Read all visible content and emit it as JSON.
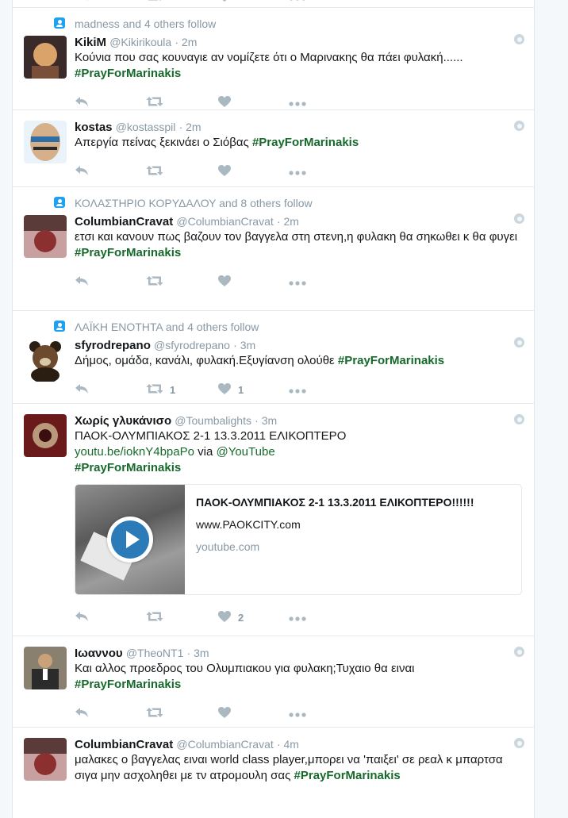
{
  "tweets": [
    {
      "context": "",
      "name": "",
      "handle": "",
      "time": "",
      "lines": [],
      "retweets": "",
      "likes": "",
      "avatar_colors": [
        "#ffffff",
        "#ffffff"
      ]
    },
    {
      "context": "madness and 4 others follow",
      "name": "KikiM",
      "handle": "@Kikirikoula",
      "time": "· 2m",
      "text": "Κούνια που σας κουναγιε αν νομίζετε ότι ο Μαρινακης θα πάει φυλακή......",
      "hashtag": "#PrayForMarinakis",
      "retweets": "",
      "likes": "",
      "avatar_colors": [
        "#d9a36a",
        "#3b2a2a"
      ]
    },
    {
      "context": "",
      "name": "kostas",
      "handle": "@kostasspil",
      "time": "· 2m",
      "text": "Απεργία πείνας ξεκινάει ο Σιόβας",
      "hashtag": "#PrayForMarinakis",
      "retweets": "",
      "likes": "",
      "avatar_colors": [
        "#2f6fa8",
        "#d6b08a"
      ]
    },
    {
      "context": "ΚΟΛΑΣΤΗΡΙΟ ΚΟΡΥΔΑΛΟΥ and 8 others follow",
      "name": "ColumbianCravat",
      "handle": "@ColumbianCravat",
      "time": "· 2m",
      "text": "ετσι και κανουν πως βαζουν τον βαγγελα στη στενη,η φυλακη θα σηκωθει κ θα φυγει",
      "hashtag": "#PrayForMarinakis",
      "retweets": "",
      "likes": "",
      "avatar_colors": [
        "#5b3a3a",
        "#c9a0a0"
      ]
    },
    {
      "context": "ΛΑΪΚΗ ΕΝΟΤΗΤΑ and 4 others follow",
      "name": "sfyrodrepano",
      "handle": "@sfyrodrepano",
      "time": "· 3m",
      "text": "Δήμος, ομάδα, κανάλι, φυλακή.Εξυγίανση ολούθε",
      "hashtag": "#PrayForMarinakis",
      "retweets": "1",
      "likes": "1",
      "avatar_colors": [
        "#6b4a2e",
        "#2a1d12"
      ]
    },
    {
      "context": "",
      "name": "Χωρίς γλυκάνισο",
      "handle": "@Toumbalights",
      "time": "· 3m",
      "text": "ΠΑΟΚ-ΟΛΥΜΠΙΑΚΟΣ 2-1 13.3.2011 ΕΛΙΚΟΠΤΕΡΟ",
      "link": "youtu.be/ioknY4bpaPo",
      "via": "via",
      "mention": "@YouTube",
      "hashtag": "#PrayForMarinakis",
      "card": {
        "title": "ΠΑΟΚ-ΟΛΥΜΠΙΑΚΟΣ 2-1 13.3.2011 ΕΛΙΚΟΠΤΕΡΟ!!!!!!",
        "site": "www.PAOKCITY.com",
        "source": "youtube.com"
      },
      "retweets": "",
      "likes": "2",
      "avatar_colors": [
        "#6a1a1a",
        "#b89a7a"
      ]
    },
    {
      "context": "",
      "name": "Ιωαννου",
      "handle": "@TheoNT1",
      "time": "· 3m",
      "text": "Και αλλος προεδρος του Ολυμπιακου για φυλακη;Τυχαιο θα ειναι",
      "hashtag": "#PrayForMarinakis",
      "retweets": "",
      "likes": "",
      "avatar_colors": [
        "#8a8070",
        "#2b2b2b"
      ]
    },
    {
      "context": "",
      "name": "ColumbianCravat",
      "handle": "@ColumbianCravat",
      "time": "· 4m",
      "text": "μαλακες ο βαγγελας ειναι world class player,μπορει να 'παιξει' σε ρεαλ κ μπαρτσα σιγα μην ασχοληθει με τν ατρομουλη σας",
      "hashtag": "#PrayForMarinakis",
      "retweets": "",
      "likes": "",
      "avatar_colors": [
        "#5b3a3a",
        "#c9a0a0"
      ]
    }
  ],
  "colors": {
    "accent": "#1da1f2",
    "hashtag": "#17692c",
    "muted": "#8899a6"
  }
}
